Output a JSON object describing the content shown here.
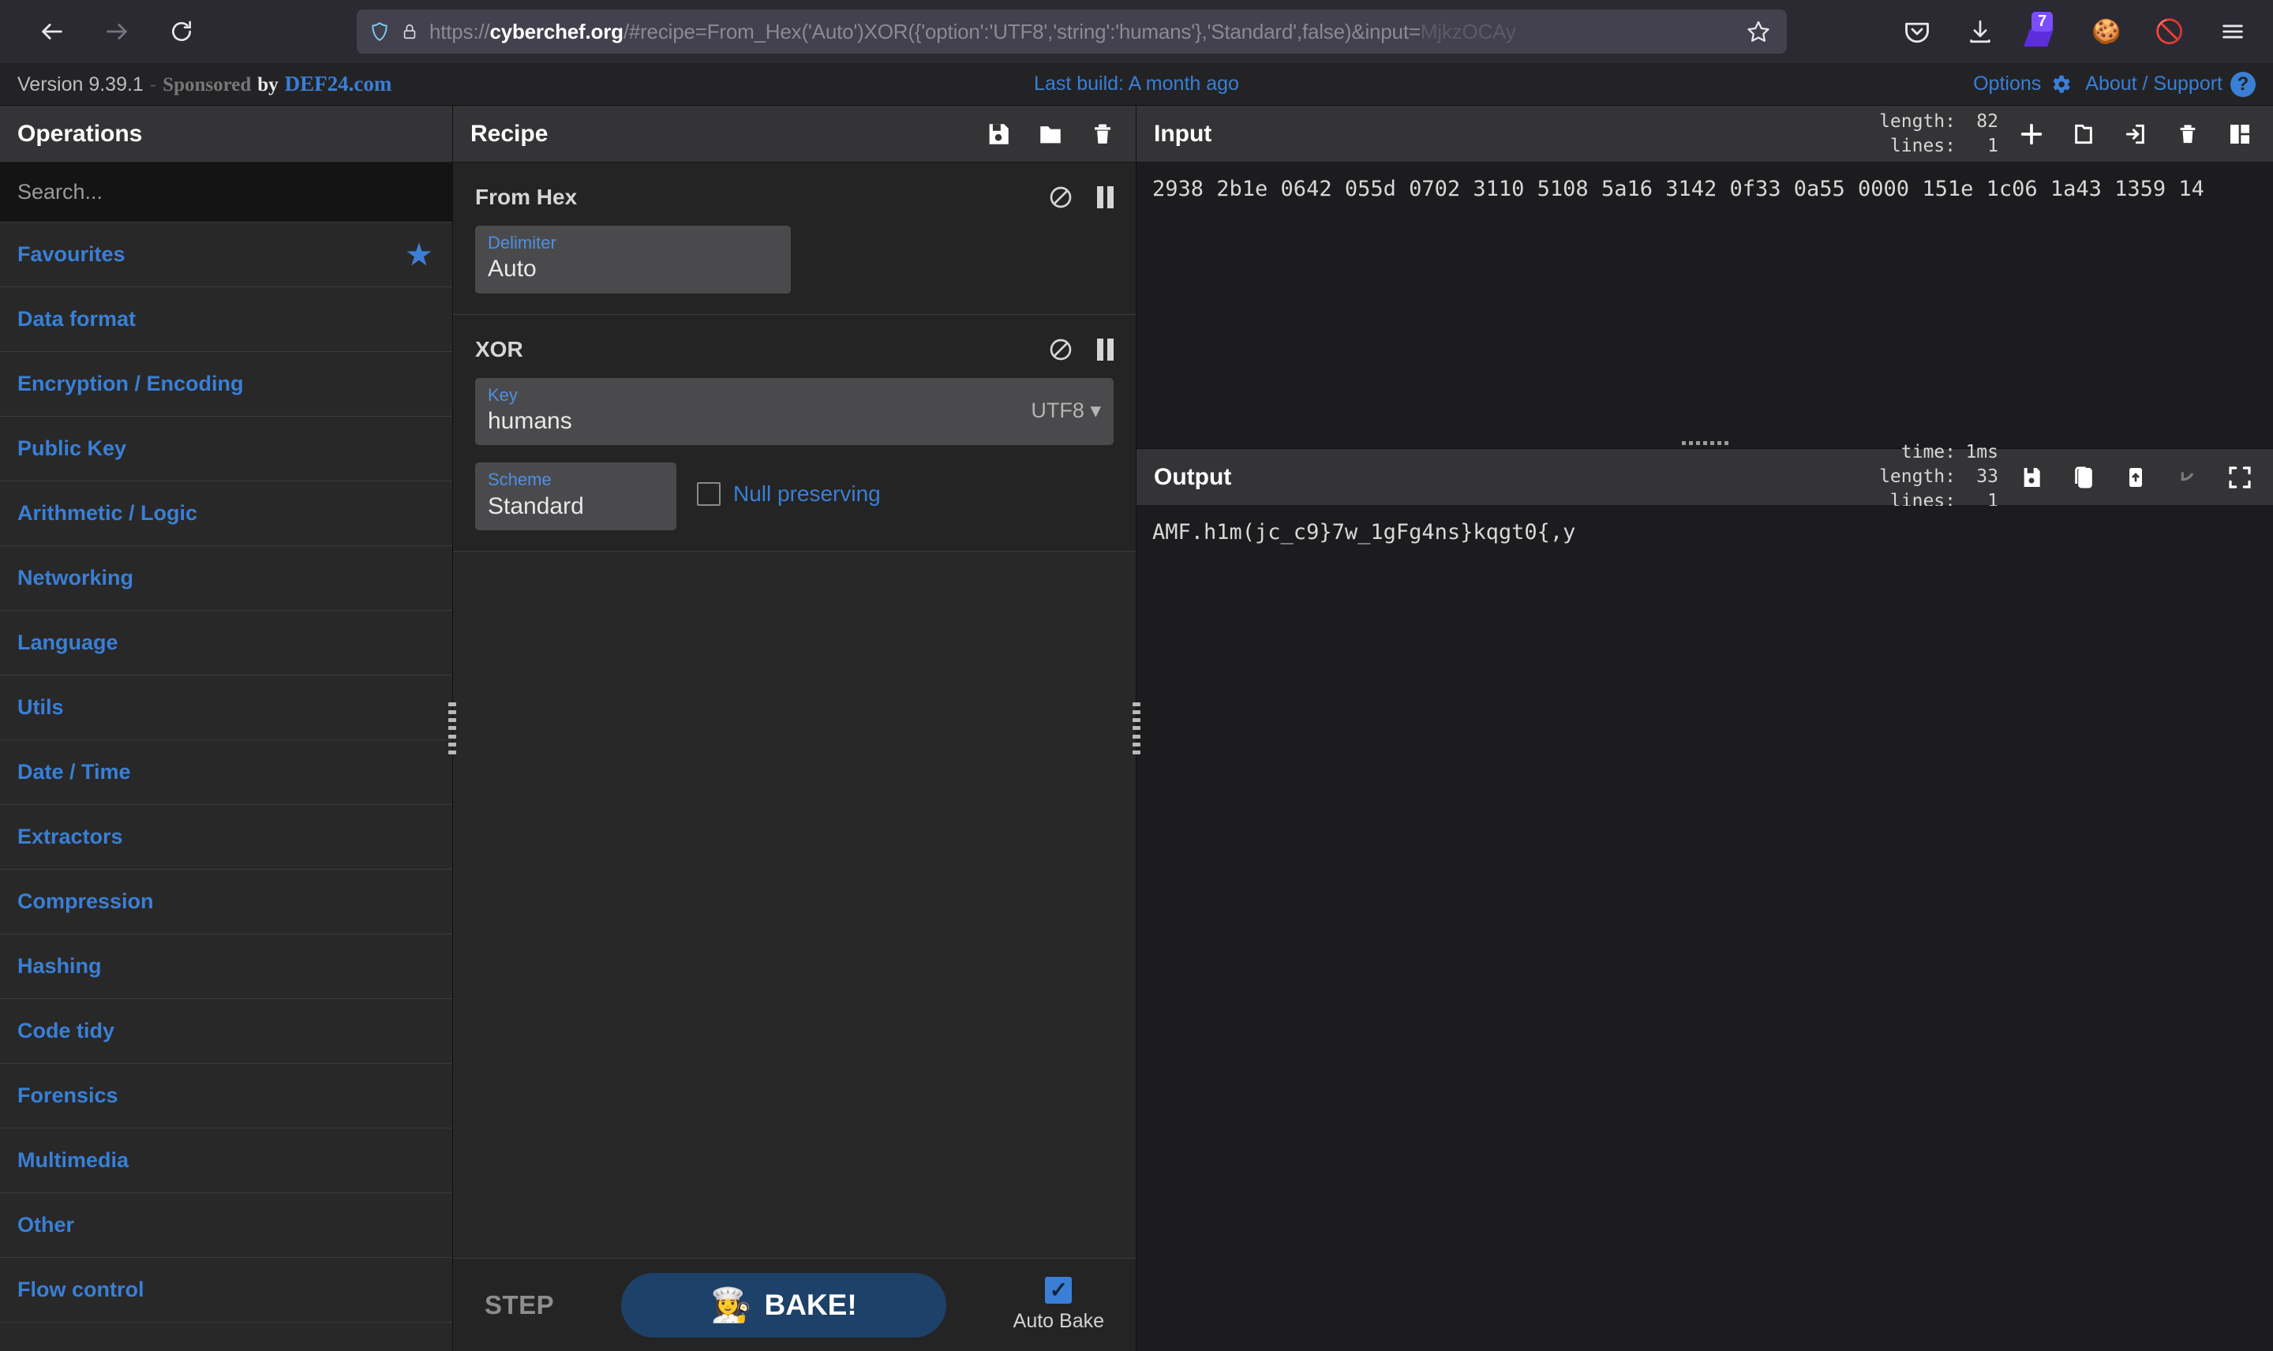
{
  "browser": {
    "back_icon": "back-arrow-icon",
    "forward_icon": "forward-arrow-icon",
    "reload_icon": "reload-icon",
    "shield_icon": "tracking-protection-shield-icon",
    "lock_icon": "padlock-icon",
    "url_scheme": "https://",
    "url_host": "cyberchef.org",
    "url_path": "/#recipe=From_Hex('Auto')XOR({'option':'UTF8','string':'humans'},'Standard',false)&input=",
    "url_tail": "MjkzOCAy",
    "star_icon": "bookmark-star-icon",
    "pocket_icon": "pocket-icon",
    "downloads_icon": "downloads-icon",
    "extension_badge": "7",
    "cookie_icon": "cookie-icon",
    "blocked_cookie_icon": "cookie-blocked-icon",
    "menu_icon": "hamburger-menu-icon"
  },
  "banner": {
    "version": "Version 9.39.1",
    "dash": "-",
    "sponsored": "Sponsored",
    "by": "by",
    "sponsor_name": "DEF24.com",
    "last_build": "Last build: A month ago",
    "options": "Options",
    "gear_icon": "gear-icon",
    "about": "About / Support",
    "help_icon": "question-mark-icon",
    "accent": "#3a7fd5"
  },
  "operations": {
    "title": "Operations",
    "search_placeholder": "Search...",
    "search_value": "",
    "star_icon": "star-icon",
    "items": [
      {
        "label": "Favourites",
        "starred": true
      },
      {
        "label": "Data format",
        "starred": false
      },
      {
        "label": "Encryption / Encoding",
        "starred": false
      },
      {
        "label": "Public Key",
        "starred": false
      },
      {
        "label": "Arithmetic / Logic",
        "starred": false
      },
      {
        "label": "Networking",
        "starred": false
      },
      {
        "label": "Language",
        "starred": false
      },
      {
        "label": "Utils",
        "starred": false
      },
      {
        "label": "Date / Time",
        "starred": false
      },
      {
        "label": "Extractors",
        "starred": false
      },
      {
        "label": "Compression",
        "starred": false
      },
      {
        "label": "Hashing",
        "starred": false
      },
      {
        "label": "Code tidy",
        "starred": false
      },
      {
        "label": "Forensics",
        "starred": false
      },
      {
        "label": "Multimedia",
        "starred": false
      },
      {
        "label": "Other",
        "starred": false
      },
      {
        "label": "Flow control",
        "starred": false
      }
    ]
  },
  "recipe": {
    "title": "Recipe",
    "save_icon": "save-icon",
    "load_icon": "folder-open-icon",
    "clear_icon": "trash-icon",
    "operations": [
      {
        "name": "From Hex",
        "disable_icon": "disable-icon",
        "breakpoint_icon": "pause-icon",
        "args": [
          {
            "label": "Delimiter",
            "value": "Auto"
          }
        ]
      },
      {
        "name": "XOR",
        "disable_icon": "disable-icon",
        "breakpoint_icon": "pause-icon",
        "args": [
          {
            "label": "Key",
            "value": "humans",
            "encoding": "UTF8"
          },
          {
            "label": "Scheme",
            "value": "Standard"
          }
        ],
        "checkbox": {
          "label": "Null preserving",
          "checked": false
        }
      }
    ],
    "step_label": "STEP",
    "bake_label": "BAKE!",
    "bake_icon": "chef-icon",
    "auto_bake_label": "Auto Bake",
    "auto_bake_checked": true
  },
  "input": {
    "title": "Input",
    "counters": [
      {
        "key": "length:",
        "value": "82"
      },
      {
        "key": "lines:",
        "value": "1"
      }
    ],
    "icons": [
      "add-tab-icon",
      "open-folder-icon",
      "open-file-as-input-icon",
      "clear-io-icon",
      "reset-layout-icon"
    ],
    "text": "2938 2b1e 0642 055d 0702 3110 5108 5a16 3142 0f33 0a55 0000 151e 1c06 1a43 1359 14"
  },
  "output": {
    "title": "Output",
    "counters": [
      {
        "key": "time:",
        "value": "1ms"
      },
      {
        "key": "length:",
        "value": "33"
      },
      {
        "key": "lines:",
        "value": "1"
      }
    ],
    "icons": [
      "save-output-icon",
      "copy-output-icon",
      "replace-input-icon",
      "undo-icon",
      "maximise-icon"
    ],
    "text": "AMF.h1m(jc_c9}7w_1gFg4ns}kqgt0{,y"
  }
}
